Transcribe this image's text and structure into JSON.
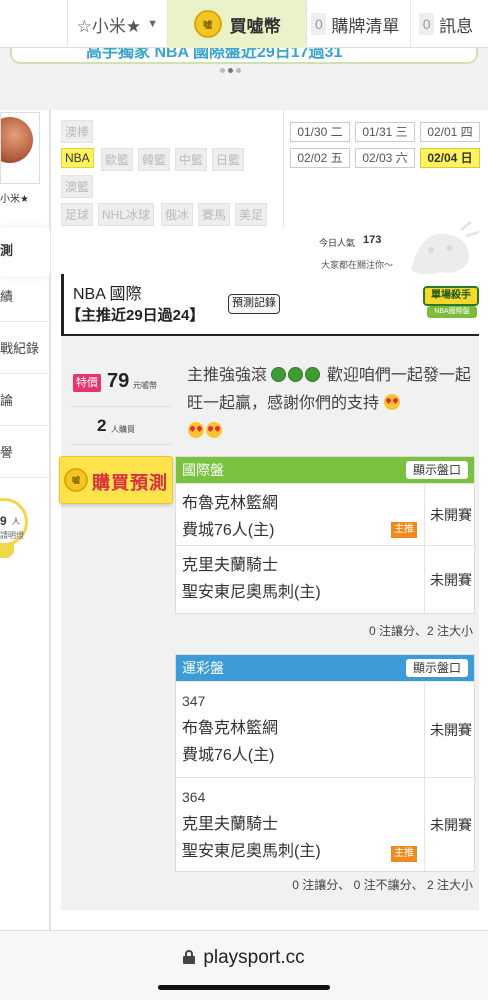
{
  "topnav": {
    "user": "☆小米★",
    "coin_icon_text": "噓",
    "coin_label": "買噓幣",
    "cart_count": "0",
    "cart_label": "購牌清單",
    "msg_count": "0",
    "msg_label": "訊息"
  },
  "banner": {
    "text": "高手獨家 NBA 國際盤近29日17過31"
  },
  "sidebar": {
    "user_name": "小米★",
    "active_tab": "測",
    "items": [
      "績",
      "戰紀錄",
      "論",
      "譽"
    ],
    "buyers_count": "9",
    "buyers_unit": "人",
    "buyers_sub": "請明燈"
  },
  "league_tags": {
    "items": [
      "澳棒",
      "NBA",
      "歐籃",
      "韓籃",
      "中籃",
      "日籃",
      "澳籃",
      "足球",
      "NHL冰球",
      "俄冰",
      "賽馬",
      "美足"
    ],
    "active": "NBA"
  },
  "dates": {
    "items": [
      "01/30 二",
      "01/31 三",
      "02/01 四",
      "02/02 五",
      "02/03 六",
      "02/04 日"
    ],
    "active": "02/04 日"
  },
  "popularity": {
    "label": "今日人氣",
    "value": "173",
    "sub": "大家都在關注你～"
  },
  "header": {
    "title": "NBA 國際",
    "subtitle": "【主推近29日過24】",
    "record_button": "預測記錄",
    "badge_top": "單場殺手",
    "badge_bottom": "NBA國際盤"
  },
  "pricing": {
    "special_label": "特價",
    "price": "79",
    "price_unit": "元噓幣",
    "buyers": "2",
    "buyers_unit": "人購買"
  },
  "comment": {
    "part1": "主推強強滾",
    "part2": "歡迎咱們一起發一起旺一起贏，感謝你們的支持"
  },
  "buy_button": "購買預測",
  "intl_table": {
    "title": "國際盤",
    "show_button": "顯示盤口",
    "rows": [
      {
        "team1": "布魯克林籃網",
        "team2": "費城76人(主)",
        "status": "未開賽",
        "tag": "主推"
      },
      {
        "team1": "克里夫蘭騎士",
        "team2": "聖安東尼奧馬刺(主)",
        "status": "未開賽",
        "tag": ""
      }
    ],
    "summary": "0 注讓分、2 注大小"
  },
  "lottery_table": {
    "title": "運彩盤",
    "show_button": "顯示盤口",
    "rows": [
      {
        "num": "347",
        "team1": "布魯克林籃網",
        "team2": "費城76人(主)",
        "status": "未開賽",
        "tag": ""
      },
      {
        "num": "364",
        "team1": "克里夫蘭騎士",
        "team2": "聖安東尼奧馬刺(主)",
        "status": "未開賽",
        "tag": "主推"
      }
    ],
    "summary": "0 注讓分、 0 注不讓分、 2 注大小"
  },
  "browser": {
    "url": "playsport.cc"
  }
}
